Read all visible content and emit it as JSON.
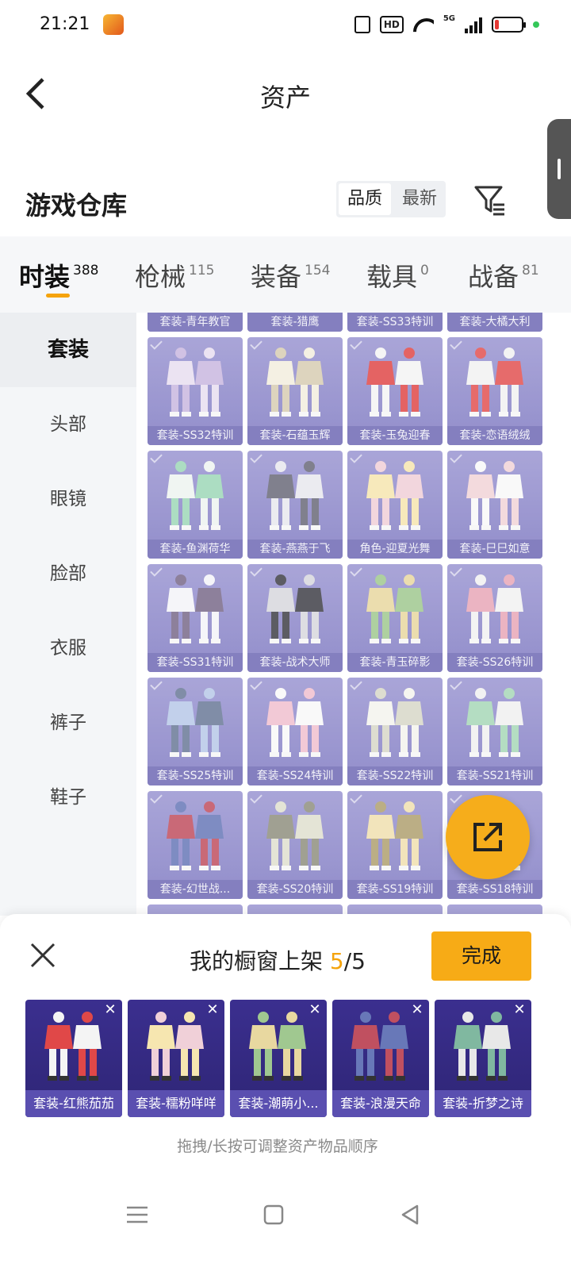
{
  "status": {
    "time": "21:21",
    "network": "5G",
    "hd": "HD",
    "app_icon_label": "和平精英"
  },
  "header": {
    "title": "资产"
  },
  "warehouse": {
    "title": "游戏仓库",
    "sort": [
      "品质",
      "最新"
    ],
    "sort_active": 0
  },
  "tabs": [
    {
      "label": "时装",
      "count": "388"
    },
    {
      "label": "枪械",
      "count": "115"
    },
    {
      "label": "装备",
      "count": "154"
    },
    {
      "label": "载具",
      "count": "0"
    },
    {
      "label": "战备",
      "count": "81"
    }
  ],
  "sidebar": [
    "套装",
    "头部",
    "眼镜",
    "脸部",
    "衣服",
    "裤子",
    "鞋子"
  ],
  "grid_top_row": [
    "套装-青年教官",
    "套装-猎鹰",
    "套装-SS33特训",
    "套装-大橘大利"
  ],
  "grid": [
    "套装-SS32特训",
    "套装-石蕴玉辉",
    "套装-玉兔迎春",
    "套装-恋语绒绒",
    "套装-鱼渊荷华",
    "套装-燕燕于飞",
    "角色-迎夏光舞",
    "套装-巳巳如意",
    "套装-SS31特训",
    "套装-战术大师",
    "套装-青玉碎影",
    "套装-SS26特训",
    "套装-SS25特训",
    "套装-SS24特训",
    "套装-SS22特训",
    "套装-SS21特训",
    "套装-幻世战...",
    "套装-SS20特训",
    "套装-SS19特训",
    "套装-SS18特训"
  ],
  "colors": {
    "accent": "#f5a30b",
    "card": "#8c87c8",
    "picked": "#35298a"
  },
  "sheet": {
    "title_prefix": "我的橱窗上架 ",
    "count_current": "5",
    "count_total": "/5",
    "done_label": "完成",
    "close_icon": "close-icon",
    "items": [
      "套装-红熊茄茄",
      "套装-糯粉咩咩",
      "套装-潮萌小...",
      "套装-浪漫天命",
      "套装-折梦之诗"
    ],
    "hint": "拖拽/长按可调整资产物品顺序"
  }
}
